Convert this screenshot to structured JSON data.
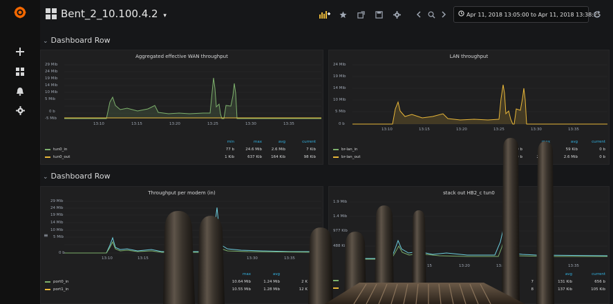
{
  "colors": {
    "green": "#7eb26d",
    "yellow": "#eab839",
    "blue": "#6ed0e0",
    "accent": "#33b5e5",
    "logo": "#f46800"
  },
  "sidebar": {
    "items": [
      {
        "icon": "plus-icon"
      },
      {
        "icon": "dashboards-icon"
      },
      {
        "icon": "bell-icon"
      },
      {
        "icon": "gear-icon"
      }
    ]
  },
  "navbar": {
    "title": "Bent_2_10.100.4.2",
    "caret": "▾",
    "time_range": "Apr 11, 2018 13:05:00 to Apr 11, 2018 13:38:25",
    "buttons": [
      "add-panel-icon",
      "star-icon",
      "share-icon",
      "save-icon",
      "settings-icon",
      "chevron-left-icon",
      "zoom-out-icon",
      "chevron-right-icon"
    ]
  },
  "rows": [
    {
      "title": "Dashboard Row"
    },
    {
      "title": "Dashboard Row"
    }
  ],
  "panels": [
    {
      "title": "Aggregated effective WAN throughput",
      "yticks": [
        "29 Mib",
        "24 Mib",
        "19 Mib",
        "14 Mib",
        "10 Mib",
        "5 Mib",
        "0 b",
        "-5 Mib"
      ],
      "xticks": [
        "13:10",
        "13:15",
        "13:20",
        "13:25",
        "13:30",
        "13:35"
      ],
      "legend_headers": [
        "min",
        "max",
        "avg",
        "current"
      ],
      "legend": [
        {
          "name": "tun0_in",
          "color": "green",
          "min": "77 b",
          "max": "24.6 Mib",
          "avg": "2.6 Mib",
          "current": "7 Kib"
        },
        {
          "name": "tun0_out",
          "color": "yellow",
          "min": "1 Kib",
          "max": "637 Kib",
          "avg": "164 Kib",
          "current": "98 Kib"
        }
      ]
    },
    {
      "title": "LAN throughput",
      "yticks": [
        "24 Mib",
        "19 Mib",
        "14 Mib",
        "10 Mib",
        "5 Mib",
        "0 b"
      ],
      "xticks": [
        "13:10",
        "13:15",
        "13:20",
        "13:25",
        "13:30",
        "13:35"
      ],
      "legend_headers": [
        "max",
        "avg",
        "current"
      ],
      "legend": [
        {
          "name": "br-lan_in",
          "color": "green",
          "min": "0 b",
          "max": "",
          "avg": "59 Kib",
          "current": "0 b"
        },
        {
          "name": "br-lan_out",
          "color": "yellow",
          "min": "0 b",
          "max": "2",
          "avg": "2.6 Mib",
          "current": "0 b"
        }
      ]
    },
    {
      "title": "Throughput per modem (in)",
      "yticks": [
        "29 Mib",
        "24 Mib",
        "19 Mib",
        "14 Mib",
        "10 Mib",
        "5 Mib",
        "0 b"
      ],
      "xticks": [
        "13:10",
        "13:15",
        "13:30",
        "13:35"
      ],
      "legend_headers": [
        "max",
        "avg",
        "curre"
      ],
      "legend": [
        {
          "name": "port0_in",
          "color": "green",
          "max": "10.64 Mib",
          "avg": "1.24 Mib",
          "current": "2 K"
        },
        {
          "name": "port1_in",
          "color": "yellow",
          "max": "10.55 Mib",
          "avg": "1.28 Mib",
          "current": "12 K"
        }
      ]
    },
    {
      "title": "stack out HB2_c tun0",
      "yticks": [
        "1.9 Mib",
        "1.4 Mib",
        "977 Kib",
        "488 Ki"
      ],
      "xticks": [
        "15",
        "13:20",
        "13:2",
        "13:35"
      ],
      "legend_headers": [
        "avg",
        "current"
      ],
      "legend": [
        {
          "name": "",
          "color": "green",
          "avg": "131 Kib",
          "current": "656 b",
          "extra": "7"
        },
        {
          "name": "",
          "color": "yellow",
          "avg": "137 Kib",
          "current": "105 Kib",
          "extra": "8"
        }
      ]
    }
  ]
}
